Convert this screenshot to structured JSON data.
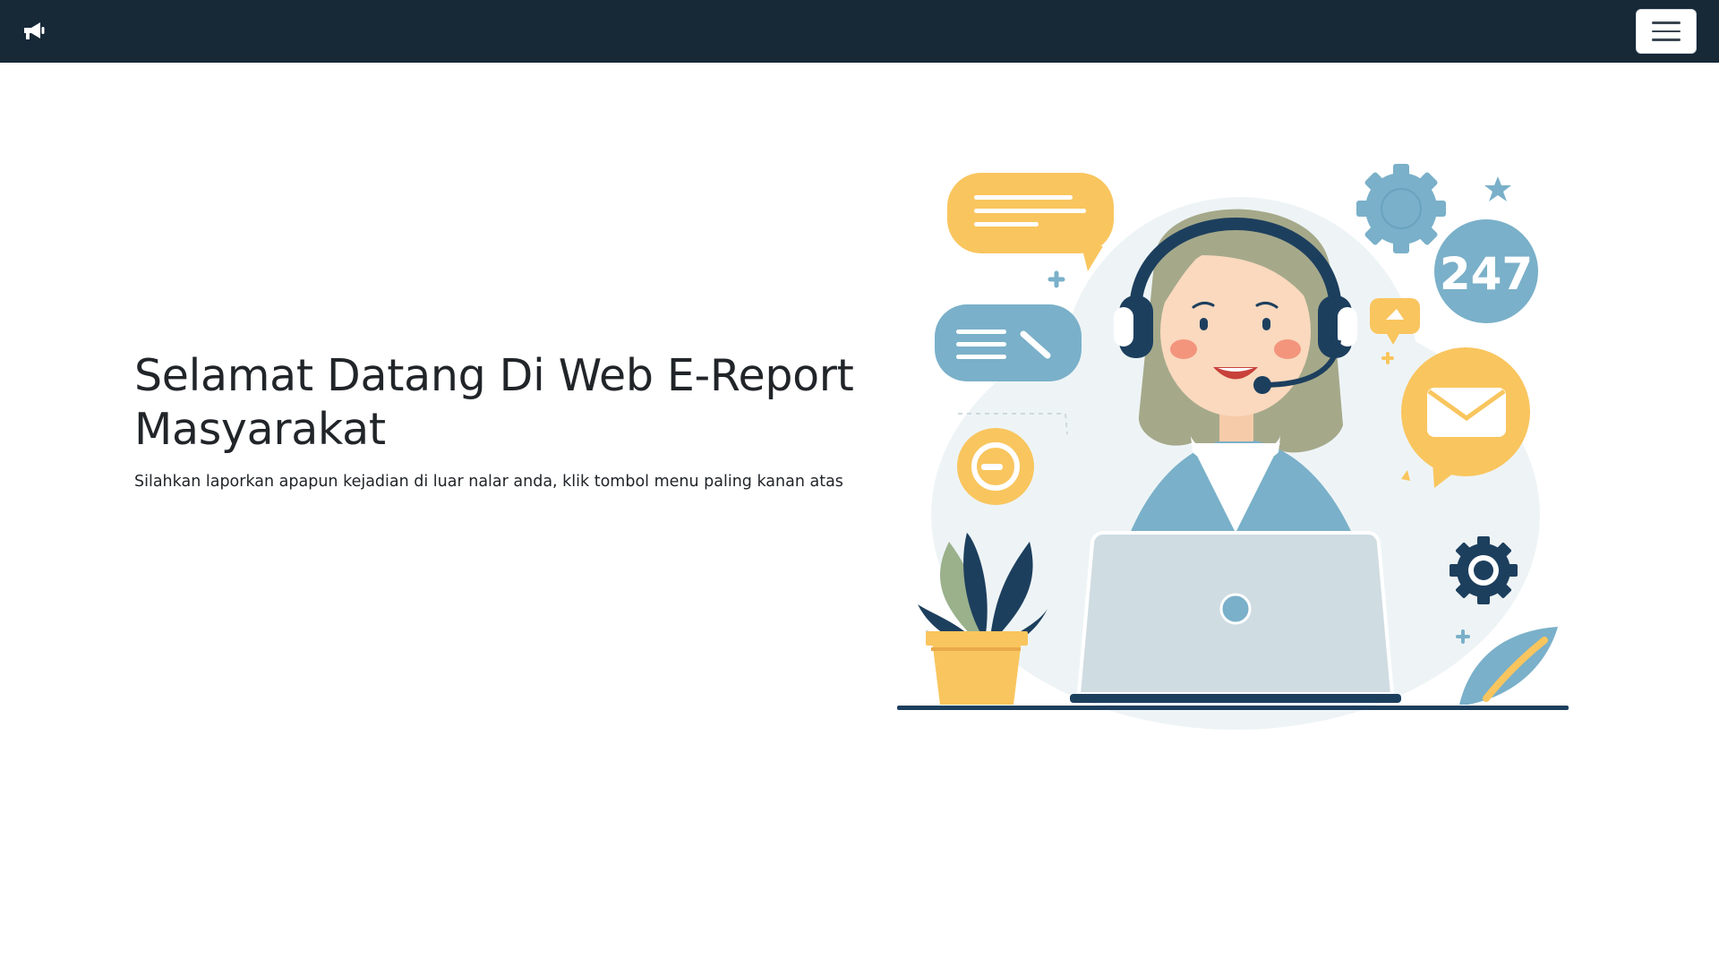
{
  "navbar": {
    "brand_icon": "megaphone-icon",
    "menu_icon": "hamburger-menu-icon",
    "background": "#172837"
  },
  "hero": {
    "title": "Selamat Datang Di Web E-Report Masyarakat",
    "subtitle": "Silahkan laporkan apapun kejadian di luar nalar anda, klik tombol menu paling kanan atas"
  },
  "illustration": {
    "badge_text": "247",
    "icons": [
      "headset-agent",
      "chat-bubble-icon",
      "gear-icon",
      "mail-icon",
      "laptop-icon",
      "plant-icon",
      "star-icon"
    ]
  },
  "colors": {
    "accent_yellow": "#F9C55E",
    "accent_blue": "#7AB0C9",
    "navy": "#1D3F5E"
  }
}
